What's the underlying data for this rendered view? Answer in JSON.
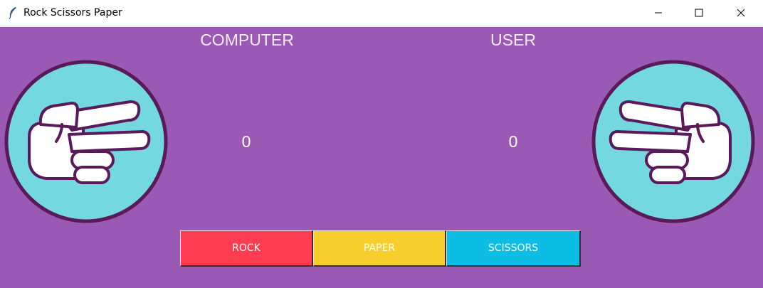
{
  "window": {
    "title": "Rock Scissors Paper",
    "icon": "feather-icon",
    "controls": [
      "minimize-icon",
      "maximize-icon",
      "close-icon"
    ]
  },
  "colors": {
    "background": "#9b59b6",
    "circle_fill": "#74d8e1",
    "circle_border": "#5a1a5a",
    "rock": "#ff3d51",
    "paper": "#f8ce2d",
    "scissors": "#0dbde3"
  },
  "players": {
    "computer": {
      "label": "COMPUTER",
      "score": "0",
      "hand_icon": "scissors-hand-icon"
    },
    "user": {
      "label": "USER",
      "score": "0",
      "hand_icon": "scissors-hand-icon"
    }
  },
  "buttons": {
    "rock": "ROCK",
    "paper": "PAPER",
    "scissors": "SCISSORS"
  }
}
